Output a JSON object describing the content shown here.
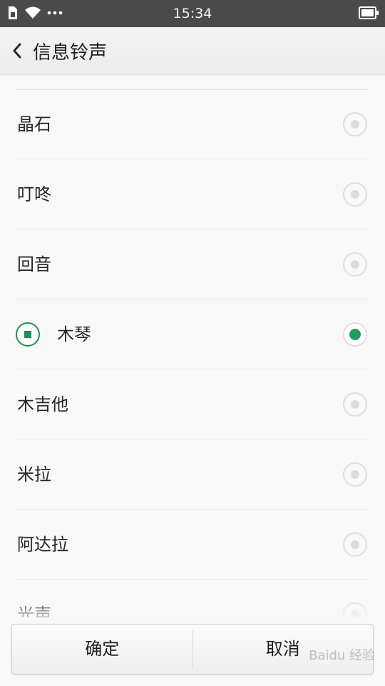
{
  "status_bar": {
    "time": "15:34",
    "icons": [
      "sim-icon",
      "wifi-icon",
      "more-dots-icon",
      "battery-icon"
    ]
  },
  "header": {
    "title": "信息铃声",
    "back_icon": "chevron-left-icon"
  },
  "ringtones": [
    {
      "label": "晶石",
      "selected": false
    },
    {
      "label": "叮咚",
      "selected": false
    },
    {
      "label": "回音",
      "selected": false
    },
    {
      "label": "木琴",
      "selected": true
    },
    {
      "label": "木吉他",
      "selected": false
    },
    {
      "label": "米拉",
      "selected": false
    },
    {
      "label": "阿达拉",
      "selected": false
    },
    {
      "label": "光声",
      "selected": false
    }
  ],
  "buttons": {
    "confirm": "确定",
    "cancel": "取消"
  },
  "colors": {
    "accent": "#1f9d5d",
    "status_bar": "#4a4a4a"
  },
  "watermark": "Baidu 经验"
}
